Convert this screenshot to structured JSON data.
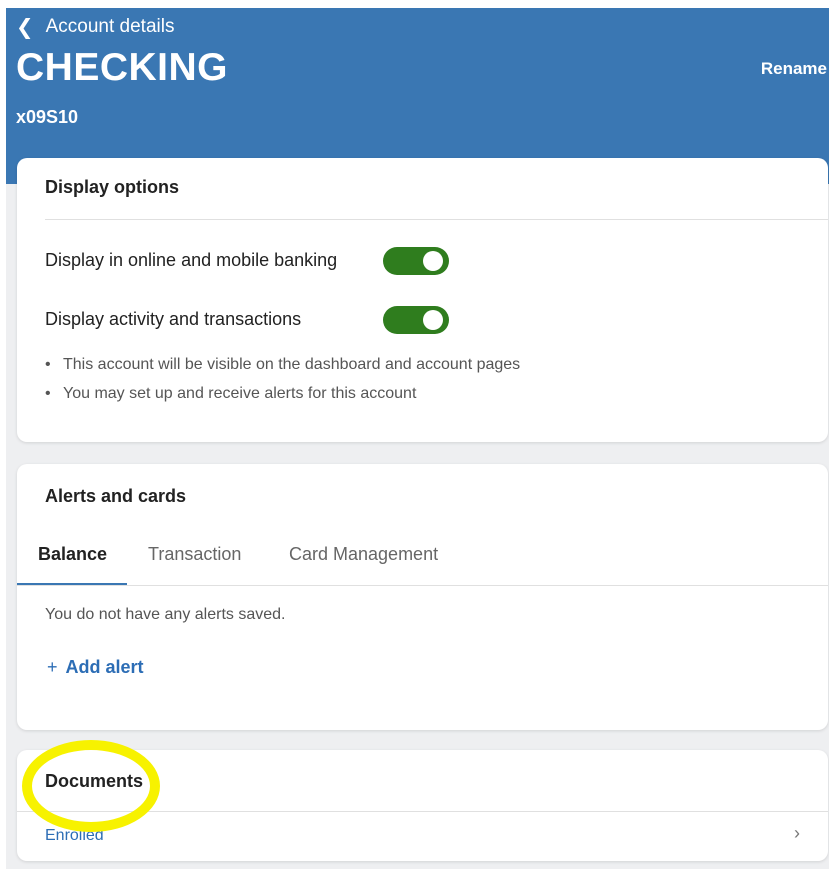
{
  "header": {
    "back_label": "Account details",
    "back_icon": "chevron-left-icon",
    "title": "CHECKING",
    "account_number": "x09S10",
    "rename_label": "Rename",
    "background_color": "#3a77b3"
  },
  "display_options": {
    "title": "Display options",
    "toggles": [
      {
        "label": "Display in online and mobile banking",
        "on": true
      },
      {
        "label": "Display activity and transactions",
        "on": true
      }
    ],
    "notes": [
      "This account will be visible on the dashboard and account pages",
      "You may set up and receive alerts for this account"
    ],
    "toggle_color": "#2f7d1e"
  },
  "alerts": {
    "title": "Alerts and cards",
    "tabs": [
      {
        "label": "Balance",
        "active": true
      },
      {
        "label": "Transaction",
        "active": false
      },
      {
        "label": "Card Management",
        "active": false
      }
    ],
    "empty_message": "You do not have any alerts saved.",
    "add_label": "Add alert",
    "add_icon": "plus-icon"
  },
  "documents": {
    "title": "Documents",
    "status": "Enrolled",
    "chevron_icon": "chevron-right-icon"
  },
  "annotation": {
    "highlight_color": "#f7f200"
  }
}
